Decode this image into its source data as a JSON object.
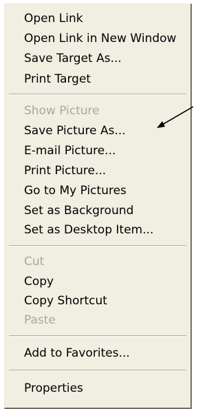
{
  "menu": {
    "items": [
      {
        "label": "Open Link",
        "enabled": true
      },
      {
        "label": "Open Link in New Window",
        "enabled": true
      },
      {
        "label": "Save Target As...",
        "enabled": true
      },
      {
        "label": "Print Target",
        "enabled": true
      },
      {
        "label": "Show Picture",
        "enabled": false
      },
      {
        "label": "Save Picture As...",
        "enabled": true
      },
      {
        "label": "E-mail Picture...",
        "enabled": true
      },
      {
        "label": "Print Picture...",
        "enabled": true
      },
      {
        "label": "Go to My Pictures",
        "enabled": true
      },
      {
        "label": "Set as Background",
        "enabled": true
      },
      {
        "label": "Set as Desktop Item...",
        "enabled": true
      },
      {
        "label": "Cut",
        "enabled": false
      },
      {
        "label": "Copy",
        "enabled": true
      },
      {
        "label": "Copy Shortcut",
        "enabled": true
      },
      {
        "label": "Paste",
        "enabled": false
      },
      {
        "label": "Add to Favorites...",
        "enabled": true
      },
      {
        "label": "Properties",
        "enabled": true
      }
    ]
  },
  "colors": {
    "menu_background": "#f1efe2",
    "text_enabled": "#000000",
    "text_disabled": "#aca899",
    "separator": "#aca899",
    "annotation_arrow": "#000000"
  },
  "annotation": {
    "icon": "arrow-pointer",
    "points_to": "Save Picture As..."
  }
}
